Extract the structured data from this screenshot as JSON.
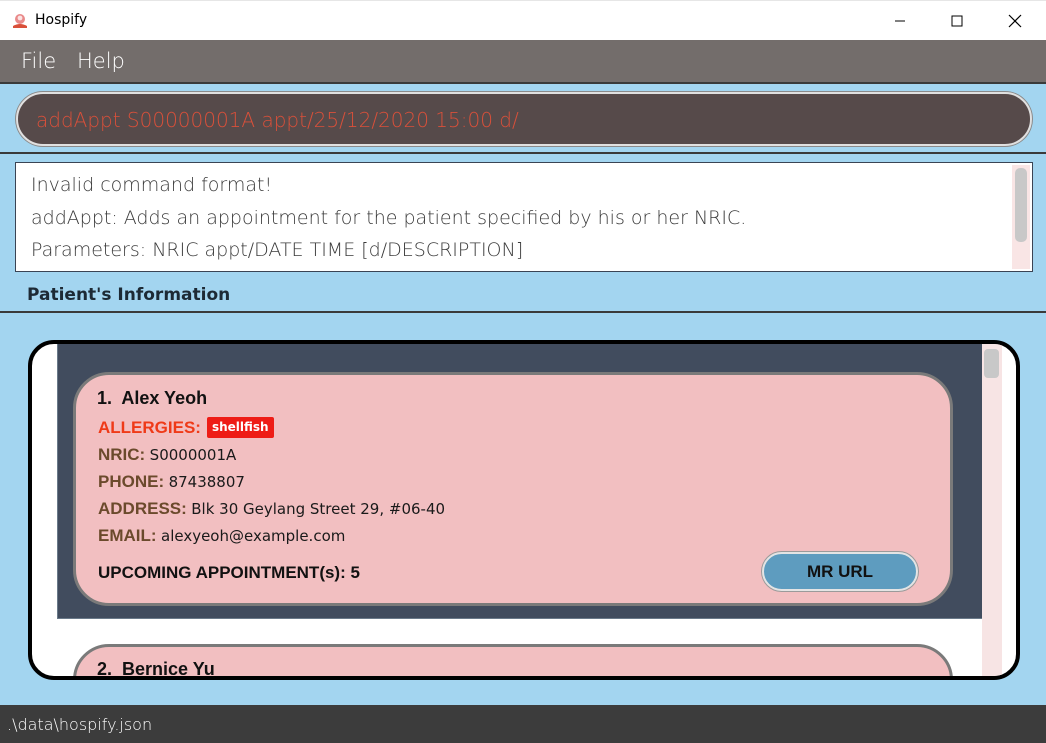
{
  "window": {
    "title": "Hospify",
    "icon": "hospify-logo-icon",
    "controls": [
      "minimize-icon",
      "maximize-icon",
      "close-icon"
    ]
  },
  "menu": {
    "file_label": "File",
    "help_label": "Help"
  },
  "command": {
    "value": "addAppt S00000001A appt/25/12/2020 15:00 d/"
  },
  "result": {
    "lines": [
      "Invalid command format!",
      "addAppt: Adds an appointment for the patient specified by his or her NRIC.",
      "Parameters: NRIC appt/DATE TIME [d/DESCRIPTION]"
    ]
  },
  "patient_section": {
    "heading": "Patient's Information"
  },
  "patients": [
    {
      "index": "1.",
      "name": "Alex Yeoh",
      "allergies_label": "ALLERGIES:",
      "allergies": [
        "shellfish"
      ],
      "nric_label": "NRIC:",
      "nric": "S0000001A",
      "phone_label": "PHONE:",
      "phone": "87438807",
      "address_label": "ADDRESS:",
      "address": "Blk 30 Geylang Street 29, #06-40",
      "email_label": "EMAIL:",
      "email": "alexyeoh@example.com",
      "upcoming_label": "UPCOMING APPOINTMENT(s):",
      "upcoming_count": "5",
      "mr_button_label": "MR URL"
    },
    {
      "index": "2.",
      "name": "Bernice Yu"
    }
  ],
  "status": {
    "path": ".\\data\\hospify.json"
  },
  "colors": {
    "background": "#a3d5f0",
    "menubar": "#736d6b",
    "command_box": "#564a4a",
    "command_text": "#d9503a",
    "card": "#f2bfc1",
    "selected_row": "#414c5e",
    "allergy_label": "#ef3a18",
    "allergy_tag": "#ee1c16",
    "field_label": "#6b4a2c",
    "mr_button": "#5e9cbf",
    "statusbar": "#3c3c3c"
  }
}
